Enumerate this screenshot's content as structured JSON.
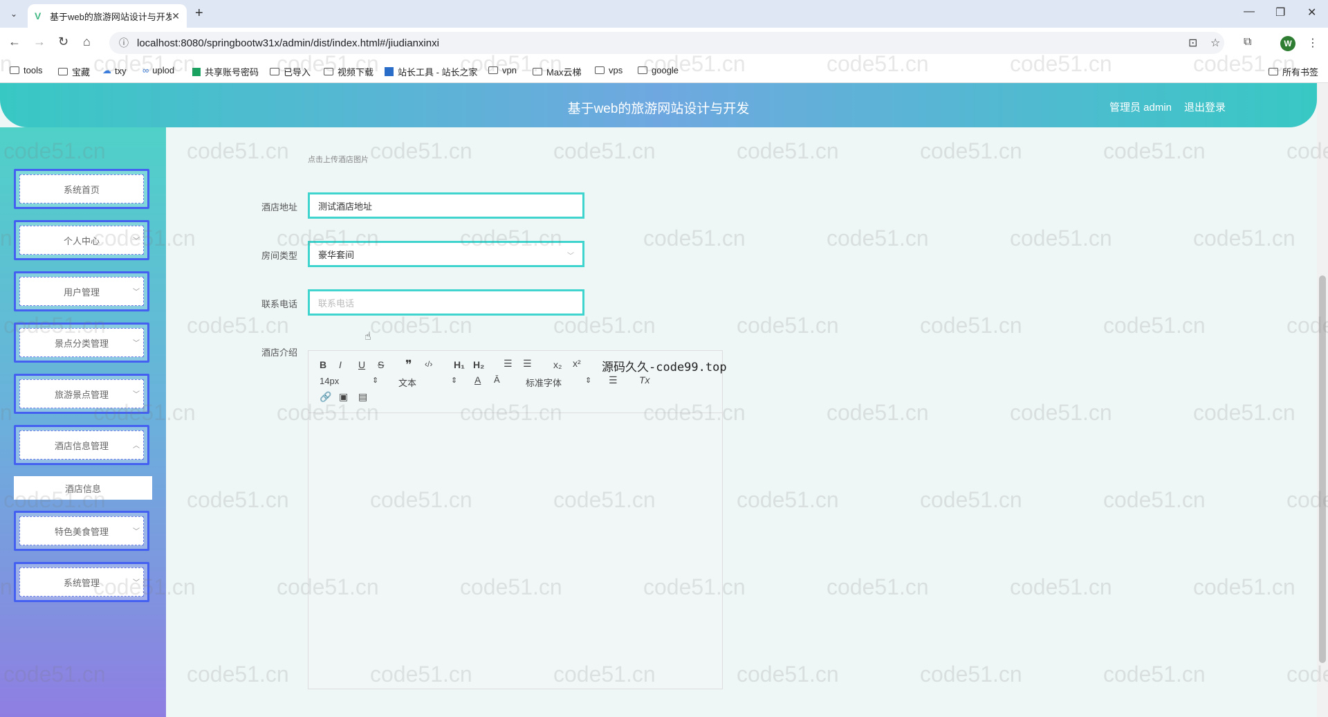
{
  "browser": {
    "tab_title": "基于web的旅游网站设计与开发",
    "url": "localhost:8080/springbootw31x/admin/dist/index.html#/jiudianxinxi",
    "bookmarks": [
      "tools",
      "宝藏",
      "txy",
      "uplod",
      "共享账号密码",
      "已导入",
      "视频下载",
      "站长工具 - 站长之家",
      "vpn",
      "Max云梯",
      "vps",
      "google"
    ],
    "all_bookmarks": "所有书签",
    "profile_initial": "W"
  },
  "header": {
    "title": "基于web的旅游网站设计与开发",
    "user": "管理员 admin",
    "logout": "退出登录"
  },
  "sidebar": {
    "items": [
      {
        "label": "系统首页",
        "has_chevron": false
      },
      {
        "label": "个人中心",
        "has_chevron": true
      },
      {
        "label": "用户管理",
        "has_chevron": true
      },
      {
        "label": "景点分类管理",
        "has_chevron": true
      },
      {
        "label": "旅游景点管理",
        "has_chevron": true
      },
      {
        "label": "酒店信息管理",
        "has_chevron": true,
        "expanded": true
      },
      {
        "label": "特色美食管理",
        "has_chevron": true
      },
      {
        "label": "系统管理",
        "has_chevron": true
      }
    ],
    "submenu": {
      "label": "酒店信息"
    }
  },
  "form": {
    "upload_hint": "点击上传酒店图片",
    "address": {
      "label": "酒店地址",
      "value": "测试酒店地址"
    },
    "room_type": {
      "label": "房间类型",
      "value": "豪华套间"
    },
    "phone": {
      "label": "联系电话",
      "placeholder": "联系电话"
    },
    "intro": {
      "label": "酒店介绍"
    }
  },
  "editor": {
    "font_size": "14px",
    "paragraph": "文本",
    "font_family": "标准字体",
    "note": "源码久久-code99.top"
  },
  "watermark": "code51.cn"
}
